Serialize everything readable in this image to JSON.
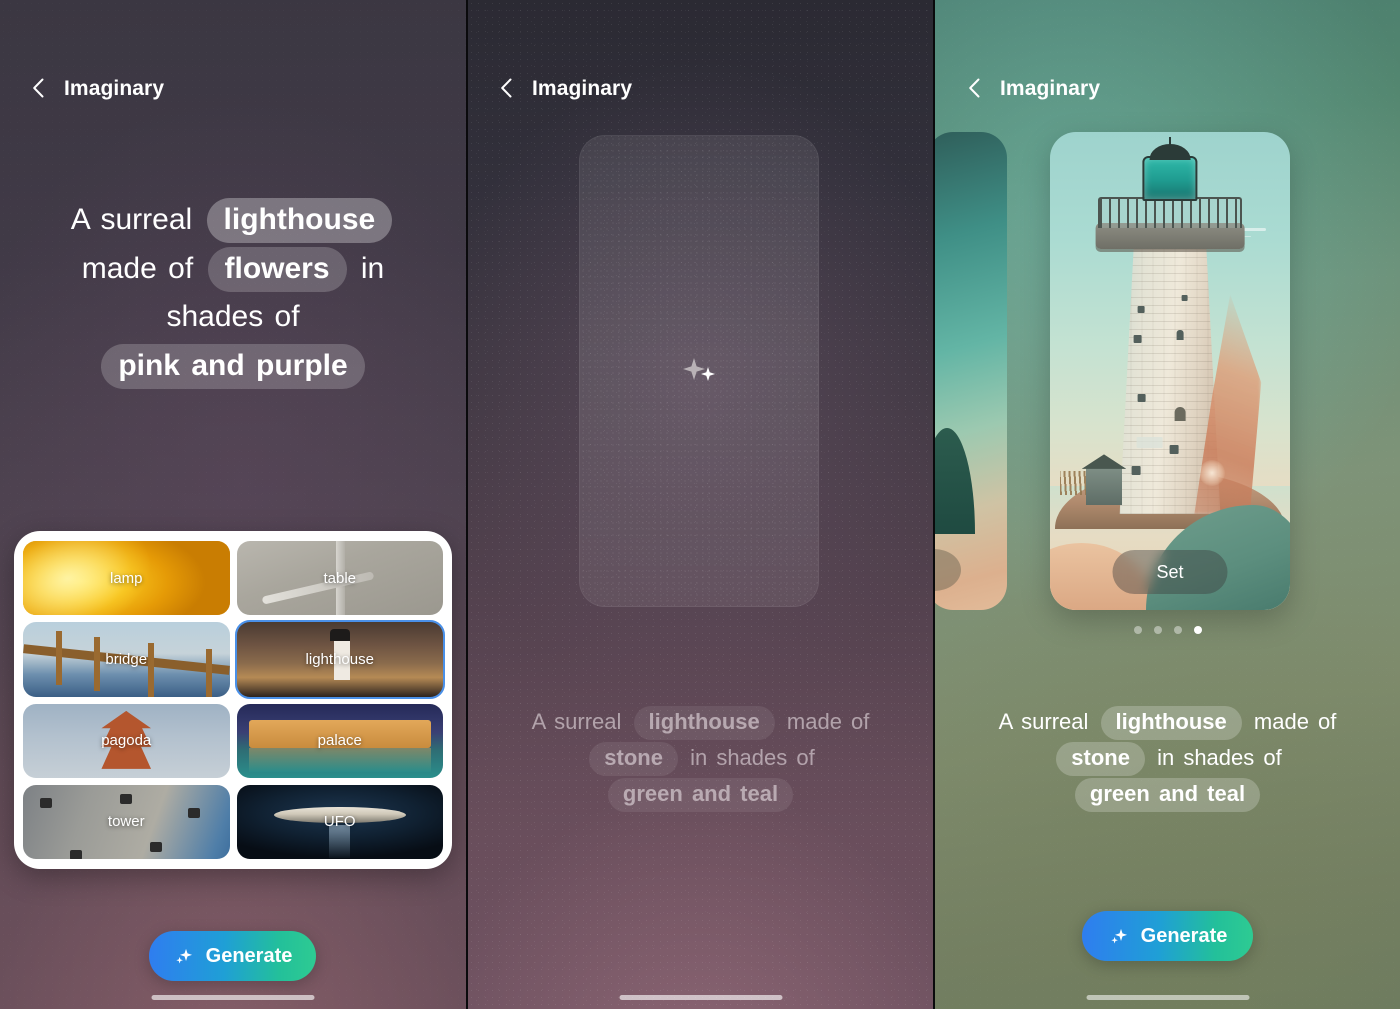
{
  "app": {
    "title": "Imaginary",
    "back_icon": "chevron-left-icon"
  },
  "panel1": {
    "header": {
      "title": "Imaginary",
      "back_icon": "chevron-left-icon"
    },
    "prompt": {
      "segments": [
        {
          "text": "A surreal",
          "type": "text"
        },
        {
          "text": "lighthouse",
          "type": "chip"
        },
        {
          "text": "made of",
          "type": "text"
        },
        {
          "text": "flowers",
          "type": "chip"
        },
        {
          "text": "in shades of",
          "type": "text"
        },
        {
          "text": "pink and purple",
          "type": "chip"
        }
      ],
      "full_text": "A surreal lighthouse made of flowers in shades of pink and purple"
    },
    "picker": {
      "selected": "lighthouse",
      "options": [
        {
          "label": "lamp",
          "art": "lamp"
        },
        {
          "label": "table",
          "art": "table"
        },
        {
          "label": "bridge",
          "art": "bridge"
        },
        {
          "label": "lighthouse",
          "art": "lighthouse"
        },
        {
          "label": "pagoda",
          "art": "pagoda"
        },
        {
          "label": "palace",
          "art": "palace"
        },
        {
          "label": "tower",
          "art": "tower"
        },
        {
          "label": "UFO",
          "art": "ufo"
        }
      ]
    },
    "generate_button": {
      "label": "Generate",
      "icon": "sparkles-icon",
      "gradient_from": "#2f7df0",
      "gradient_to": "#2ecb92"
    }
  },
  "panel2": {
    "header": {
      "title": "Imaginary",
      "back_icon": "chevron-left-icon"
    },
    "placeholder": {
      "icon": "sparkles-icon",
      "state": "generating"
    },
    "prompt": {
      "segments": [
        {
          "text": "A surreal",
          "type": "text"
        },
        {
          "text": "lighthouse",
          "type": "chip"
        },
        {
          "text": "made of",
          "type": "text"
        },
        {
          "text": "stone",
          "type": "chip"
        },
        {
          "text": "in shades of",
          "type": "text"
        },
        {
          "text": "green and teal",
          "type": "chip"
        }
      ],
      "full_text": "A surreal lighthouse made of stone in shades of green and teal"
    }
  },
  "panel3": {
    "header": {
      "title": "Imaginary",
      "back_icon": "chevron-left-icon"
    },
    "carousel": {
      "set_button_label": "Set",
      "page_count": 4,
      "active_page": 4,
      "result_alt": "surreal stone lighthouse on teal dunes"
    },
    "prompt": {
      "segments": [
        {
          "text": "A surreal",
          "type": "text"
        },
        {
          "text": "lighthouse",
          "type": "chip"
        },
        {
          "text": "made of",
          "type": "text"
        },
        {
          "text": "stone",
          "type": "chip"
        },
        {
          "text": "in shades of",
          "type": "text"
        },
        {
          "text": "green and teal",
          "type": "chip"
        }
      ],
      "full_text": "A surreal lighthouse made of stone in shades of green and teal"
    },
    "generate_button": {
      "label": "Generate",
      "icon": "sparkles-icon",
      "gradient_from": "#2f7df0",
      "gradient_to": "#2ecb92"
    }
  }
}
